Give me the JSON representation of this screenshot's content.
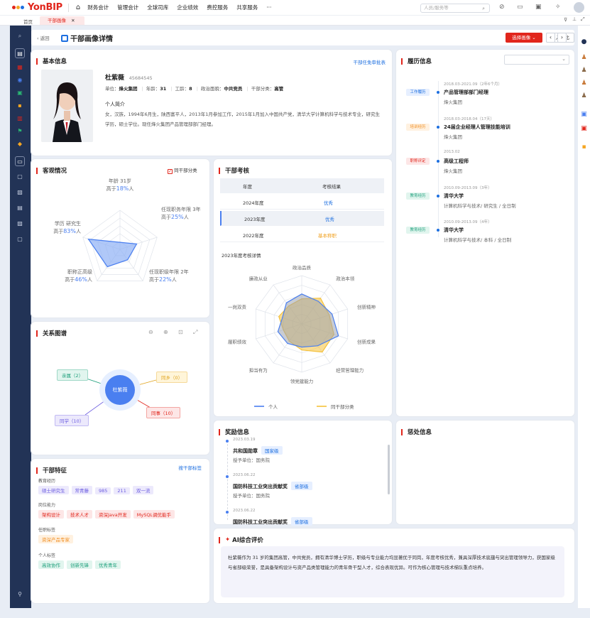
{
  "app": {
    "logo_text": "YonBIP",
    "nav": [
      "财务会计",
      "管理会计",
      "全球司库",
      "企业绩效",
      "费控服务",
      "共享服务",
      "···"
    ],
    "search_placeholder": "人员/服务等"
  },
  "tabs": {
    "home": "首页",
    "active": "干部画像",
    "close": "✕"
  },
  "header": {
    "back": "返回",
    "title": "干部画像详情",
    "select_portrait": "选择画像",
    "add_compare": "加入对比",
    "prev": "‹",
    "next": "›"
  },
  "basic": {
    "title": "基本信息",
    "appoint_link": "干部任免审批表",
    "name": "杜紫薇",
    "id": "45684545",
    "unit_label": "单位：",
    "unit_value": "烽火集团",
    "age_label": "年龄：",
    "age_value": "31",
    "seniority_label": "工龄：",
    "seniority_value": "8",
    "political_label": "政治面貌：",
    "political_value": "中共党员",
    "category_label": "干部分类：",
    "category_value": "高管",
    "intro_title": "个人简介",
    "intro_text": "女，汉族，1994年6月生，陕西富平人，2013年1月参加工作，2015年1月加入中国共产党，清华大学计算机科学与技术专业，研究生学历，硕士学位。现任烽火集团产品管理部部门经理。"
  },
  "objective": {
    "title": "客观情况",
    "filter_label": "同干部分类",
    "filter_checked": true,
    "axes": [
      {
        "name": "年龄 31岁",
        "prefix": "高于",
        "pct": "18%",
        "suffix": "人",
        "value": 0.18
      },
      {
        "name": "任现职务年限 3年",
        "prefix": "高于",
        "pct": "25%",
        "suffix": "人",
        "value": 0.45
      },
      {
        "name": "任现职级年限 2年",
        "prefix": "高于",
        "pct": "22%",
        "suffix": "人",
        "value": 0.33
      },
      {
        "name": "职称正高级",
        "prefix": "高于",
        "pct": "46%",
        "suffix": "人",
        "value": 0.55
      },
      {
        "name": "学历 研究生",
        "prefix": "高于",
        "pct": "83%",
        "suffix": "人",
        "value": 0.85
      }
    ]
  },
  "assessment": {
    "title": "干部考核",
    "col_year": "年度",
    "col_result": "考核结果",
    "rows": [
      {
        "year": "2024年度",
        "result": "优秀",
        "color": "#1d6fe0"
      },
      {
        "year": "2023年度",
        "result": "优秀",
        "color": "#1d6fe0"
      },
      {
        "year": "2022年度",
        "result": "基本称职",
        "color": "#f0a01e"
      }
    ],
    "detail_title": "2023年度考核详情",
    "radar_axes": [
      "政治品质",
      "政治本领",
      "创新精神",
      "创新成果",
      "经营管理能力",
      "领党建能力",
      "担当有为",
      "履职绩效",
      "一岗双责",
      "廉政从业"
    ],
    "series": [
      {
        "name": "个人",
        "color": "#4a7ff0",
        "values": [
          0.62,
          0.58,
          0.66,
          0.8,
          0.56,
          0.48,
          0.5,
          0.52,
          0.42,
          0.54
        ]
      },
      {
        "name": "同干部分类",
        "color": "#f5c13a",
        "values": [
          0.52,
          0.66,
          0.6,
          0.7,
          0.72,
          0.54,
          0.44,
          0.4,
          0.5,
          0.46
        ]
      }
    ]
  },
  "resume": {
    "title": "履历信息",
    "items": [
      {
        "badge": "工作履历",
        "color": "#1d6fe0",
        "bg": "#e6efff",
        "date": "2018.03-2021.09（2年6个月）",
        "title": "产品管理部部门经理",
        "org": "烽火集团"
      },
      {
        "badge": "培训经历",
        "color": "#f08c1e",
        "bg": "#fff1e0",
        "date": "2018.03-2018.04（17天）",
        "title": "24届企业经理人管理技能培训",
        "org": "烽火集团"
      },
      {
        "badge": "职称评定",
        "color": "#e1261c",
        "bg": "#fde6e6",
        "date": "2013.02",
        "title": "高级工程师",
        "org": "烽火集团"
      },
      {
        "badge": "教育经历",
        "color": "#1b9e7a",
        "bg": "#e1f5ee",
        "date": "2010.09-2013.09（3年）",
        "title": "清华大学",
        "org": "计算机科学与技术/ 研究生 / 全日制"
      },
      {
        "badge": "教育经历",
        "color": "#1b9e7a",
        "bg": "#e1f5ee",
        "date": "2010.09-2013.09（4年）",
        "title": "清华大学",
        "org": "计算机科学与技术/ 本科 / 全日制"
      }
    ]
  },
  "relation": {
    "title": "关系图谱",
    "center": "杜紫薇",
    "nodes": [
      {
        "label": "亲属（2）",
        "color": "#1b9e7a",
        "bg": "#e1f5ee"
      },
      {
        "label": "同乡（0）",
        "color": "#e0a21a",
        "bg": "#fff5d9"
      },
      {
        "label": "同事（10）",
        "color": "#e1261c",
        "bg": "#fde6e6"
      },
      {
        "label": "同学（10）",
        "color": "#6b5ce0",
        "bg": "#ece9fc"
      }
    ]
  },
  "features": {
    "title": "干部特征",
    "search_link": "搜干部标签",
    "groups": [
      {
        "label": "教育经历",
        "color": "#6b5ce0",
        "bg": "#ece9fc",
        "tags": [
          "硕士研究生",
          "常青藤",
          "985",
          "211",
          "双一流"
        ]
      },
      {
        "label": "岗位能力",
        "color": "#e1261c",
        "bg": "#fde6e6",
        "tags": [
          "架构设计",
          "技术人才",
          "资深Java开发",
          "MySQL调优能手"
        ]
      },
      {
        "label": "任职标签",
        "color": "#f08c1e",
        "bg": "#fff1e0",
        "tags": [
          "资深产品专家"
        ]
      },
      {
        "label": "个人标签",
        "color": "#1b9e7a",
        "bg": "#e1f5ee",
        "tags": [
          "高效协作",
          "创新先锋",
          "优秀青年"
        ]
      }
    ]
  },
  "awards": {
    "title": "奖励信息",
    "unit_label": "授予单位：",
    "items": [
      {
        "date": "2023.03.19",
        "name": "共和国勋章",
        "level": "国家级",
        "level_color": "#1d6fe0",
        "level_bg": "#e6efff",
        "unit": "国务院"
      },
      {
        "date": "2023.06.22",
        "name": "国防科技工业突出贡献奖",
        "level": "省部级",
        "level_color": "#1d6fe0",
        "level_bg": "#e6efff",
        "unit": "国务院"
      },
      {
        "date": "2023.06.22",
        "name": "国防科技工业突出贡献奖",
        "level": "省部级",
        "level_color": "#1d6fe0",
        "level_bg": "#e6efff",
        "unit": ""
      }
    ]
  },
  "punish": {
    "title": "惩处信息"
  },
  "ai": {
    "title": "AI综合评价",
    "text": "杜紫薇作为 31 岁的集团高管，中共党员，拥有清华博士学历，职级与专业能力均显著优于同岗，年度考核优秀，兼具深厚技术底蕴与突出管理领导力，获国家级与省部级荣誉，是具备架构设计与资产品类管理能力的青年骨干型人才，综合表现优异。可作为核心管理与技术梯队重点培养。"
  }
}
